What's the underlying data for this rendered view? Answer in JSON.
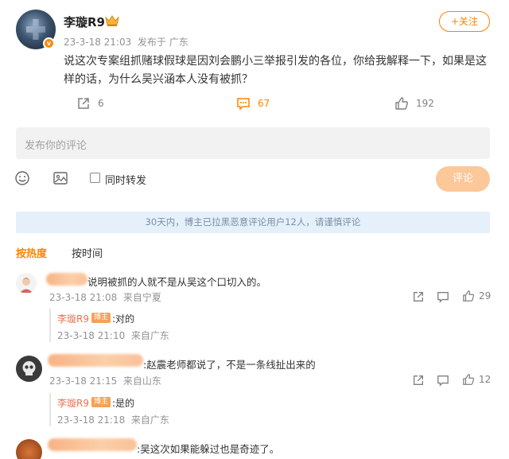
{
  "post": {
    "author": "李璇R9",
    "time": "23-3-18 21:03",
    "source": "发布于 广东",
    "text": "说这次专案组抓赌球假球是因刘会鹏小三举报引发的各位，你给我解释一下，如果是这样的话，为什么吴兴涵本人没有被抓？",
    "follow_label": "+关注",
    "vip_mark": "v",
    "actions": {
      "share_count": "6",
      "comment_count": "67",
      "like_count": "192"
    }
  },
  "composer": {
    "placeholder": "发布你的评论",
    "repost_label": "同时转发",
    "submit_label": "评论"
  },
  "notice": "30天内，博主已拉黑恶意评论用户12人，请谨慎评论",
  "tabs": {
    "hot": "按热度",
    "time": "按时间"
  },
  "comments": [
    {
      "text": "说明被抓的人就不是从吴这个口切入的。",
      "time": "23-3-18 21:08",
      "source": "来自宁夏",
      "likes": "29",
      "reply": {
        "name": "李璇R9",
        "badge": "博主",
        "text": ":对的",
        "time": "23-3-18 21:10",
        "source": "来自广东"
      }
    },
    {
      "text": ":赵震老师都说了，不是一条线扯出来的",
      "time": "23-3-18 21:15",
      "source": "来自山东",
      "likes": "12",
      "reply": {
        "name": "李璇R9",
        "badge": "博主",
        "text": ":是的",
        "time": "23-3-18 21:18",
        "source": "来自广东"
      }
    },
    {
      "text": ":吴这次如果能躲过也是奇迹了。"
    }
  ],
  "colors": {
    "accent": "#ff8200",
    "notice_bg": "#e5f0fb",
    "reply_name": "#eb7350"
  }
}
